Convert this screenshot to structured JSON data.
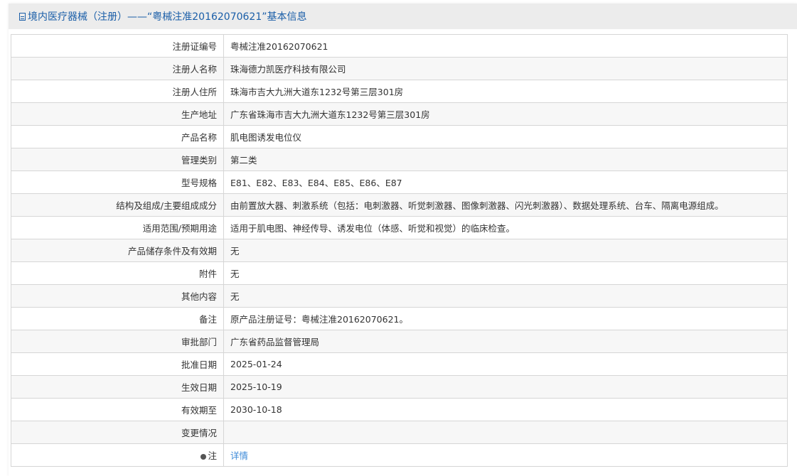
{
  "header": {
    "title": "境内医疗器械（注册）——“粤械注准20162070621”基本信息",
    "icon": "document-icon"
  },
  "rows": [
    {
      "label": "注册证编号",
      "value": "粤械注准20162070621"
    },
    {
      "label": "注册人名称",
      "value": "珠海德力凯医疗科技有限公司"
    },
    {
      "label": "注册人住所",
      "value": "珠海市吉大九洲大道东1232号第三层301房"
    },
    {
      "label": "生产地址",
      "value": "广东省珠海市吉大九洲大道东1232号第三层301房"
    },
    {
      "label": "产品名称",
      "value": "肌电图诱发电位仪"
    },
    {
      "label": "管理类别",
      "value": "第二类"
    },
    {
      "label": "型号规格",
      "value": "E81、E82、E83、E84、E85、E86、E87"
    },
    {
      "label": "结构及组成/主要组成成分",
      "value": "由前置放大器、刺激系统（包括：电刺激器、听觉刺激器、图像刺激器、闪光刺激器）、数据处理系统、台车、隔离电源组成。"
    },
    {
      "label": "适用范围/预期用途",
      "value": "适用于肌电图、神经传导、诱发电位（体感、听觉和视觉）的临床检查。"
    },
    {
      "label": "产品储存条件及有效期",
      "value": "无"
    },
    {
      "label": "附件",
      "value": "无"
    },
    {
      "label": "其他内容",
      "value": "无"
    },
    {
      "label": "备注",
      "value": "原产品注册证号：粤械注准20162070621。"
    },
    {
      "label": "审批部门",
      "value": "广东省药品监督管理局"
    },
    {
      "label": "批准日期",
      "value": "2025-01-24"
    },
    {
      "label": "生效日期",
      "value": "2025-10-19"
    },
    {
      "label": "有效期至",
      "value": "2030-10-18"
    },
    {
      "label": "变更情况",
      "value": ""
    }
  ],
  "note": {
    "label": "注",
    "link": "详情",
    "icon": "pin-icon"
  }
}
